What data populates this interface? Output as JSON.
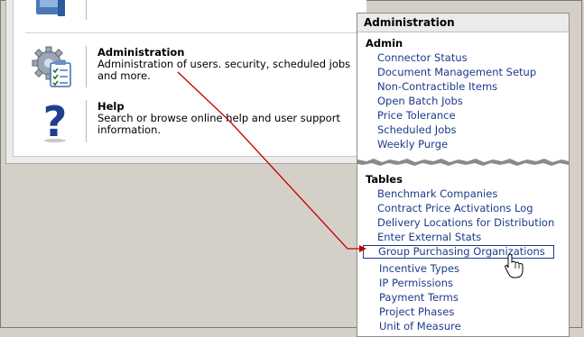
{
  "main": {
    "items": [
      {
        "icon": "admin-gear-checklist-icon",
        "title": "Administration",
        "description": "Administration of users. security, scheduled jobs and more."
      },
      {
        "icon": "help-question-icon",
        "title": "Help",
        "description": "Search or browse online help and user support information."
      }
    ]
  },
  "menu": {
    "title": "Administration",
    "sections": [
      {
        "title": "Admin",
        "links": [
          "Connector Status",
          "Document Management Setup",
          "Non-Contractible Items",
          "Open Batch Jobs",
          "Price Tolerance",
          "Scheduled Jobs",
          "Weekly Purge"
        ]
      },
      {
        "title": "Tables",
        "links": [
          "Benchmark Companies",
          "Contract Price Activations Log",
          "Delivery Locations for Distribution",
          "Enter External Stats",
          "Group Purchasing Organizations",
          "Incentive Types",
          "IP Permissions",
          "Payment Terms",
          "Project Phases",
          "Unit of Measure"
        ]
      }
    ],
    "highlighted_link": "Group Purchasing Organizations"
  },
  "colors": {
    "link": "#1d3a8a",
    "callout_arrow": "#c00000",
    "header_bg": "#ebebeb"
  }
}
